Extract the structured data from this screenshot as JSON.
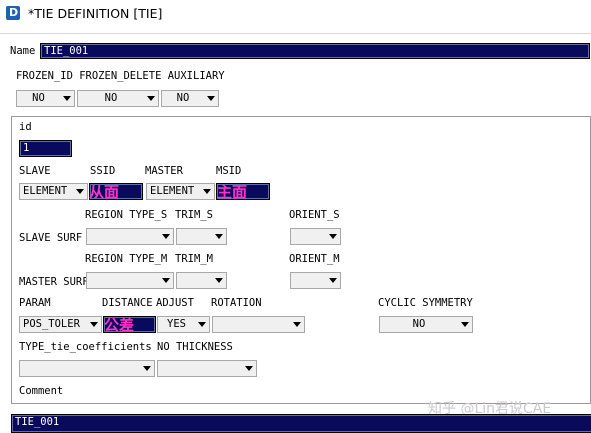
{
  "window": {
    "title": "*TIE DEFINITION [TIE]",
    "icon": "document-icon"
  },
  "name_label": "Name",
  "name_value": "TIE_001",
  "flags": {
    "header": "FROZEN_ID FROZEN_DELETE AUXILIARY",
    "frozen_id": "NO",
    "frozen_delete": "NO",
    "auxiliary": "NO"
  },
  "id_label": "id",
  "id_value": "1",
  "slave_master": {
    "slave_label": "SLAVE",
    "ssid_label": "SSID",
    "master_label": "MASTER",
    "msid_label": "MSID",
    "slave_type": "ELEMENT",
    "master_type": "ELEMENT"
  },
  "slave_surf": {
    "headers": [
      "REGION TYPE_S",
      "TRIM_S",
      "ORIENT_S"
    ],
    "label": "SLAVE SURF"
  },
  "master_surf": {
    "headers": [
      "REGION TYPE_M",
      "TRIM_M",
      "ORIENT_M"
    ],
    "label": "MASTER SURF"
  },
  "param_row": {
    "param_label": "PARAM",
    "distance_label": "DISTANCE",
    "adjust_label": "ADJUST",
    "rotation_label": "ROTATION",
    "cyclic_label": "CYCLIC SYMMETRY",
    "param_value": "POS_TOLER",
    "adjust_value": "YES",
    "cyclic_value": "NO"
  },
  "coeff_row": {
    "type_label": "TYPE_tie_coefficients",
    "thickness_label": "NO THICKNESS"
  },
  "comment_label": "Comment",
  "bottom_value": "TIE_001",
  "annotations": {
    "slave_face": "从面",
    "master_face": "主面",
    "tolerance": "公差"
  },
  "watermark": "知乎 @Lin君说CAE"
}
